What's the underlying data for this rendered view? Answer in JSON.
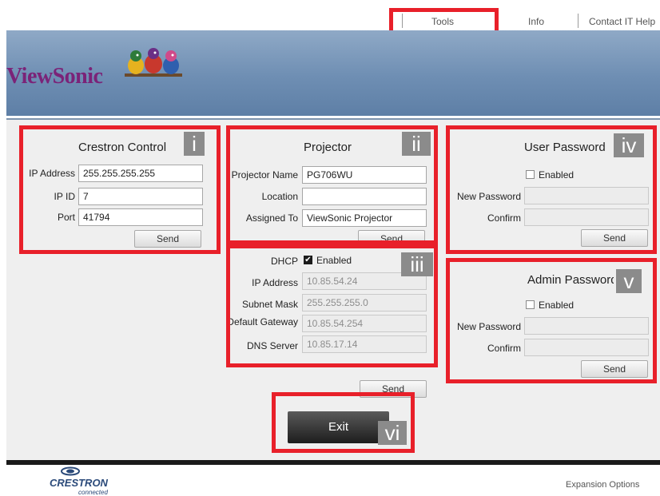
{
  "topnav": {
    "tools": "Tools",
    "info": "Info",
    "contact": "Contact IT Help"
  },
  "brand": {
    "logo_text": "ViewSonic"
  },
  "crestron": {
    "title": "Crestron Control",
    "tag": "i",
    "ip_label": "IP Address",
    "ip_value": "255.255.255.255",
    "ipid_label": "IP ID",
    "ipid_value": "7",
    "port_label": "Port",
    "port_value": "41794",
    "send": "Send"
  },
  "projector": {
    "title": "Projector",
    "tag": "ii",
    "name_label": "Projector Name",
    "name_value": "PG706WU",
    "location_label": "Location",
    "location_value": "",
    "assigned_label": "Assigned To",
    "assigned_value": "ViewSonic Projector",
    "send": "Send"
  },
  "network": {
    "tag": "iii",
    "dhcp_label": "DHCP",
    "dhcp_checked": true,
    "dhcp_text": "Enabled",
    "ip_label": "IP Address",
    "ip_value": "10.85.54.24",
    "mask_label": "Subnet Mask",
    "mask_value": "255.255.255.0",
    "gateway_label": "Default Gateway",
    "gateway_value": "10.85.54.254",
    "dns_label": "DNS Server",
    "dns_value": "10.85.17.14",
    "send": "Send"
  },
  "user_password": {
    "title": "User Password",
    "tag": "iv",
    "enabled_text": "Enabled",
    "new_label": "New Password",
    "confirm_label": "Confirm",
    "send": "Send"
  },
  "admin_password": {
    "title": "Admin Password",
    "tag": "v",
    "enabled_text": "Enabled",
    "new_label": "New Password",
    "confirm_label": "Confirm",
    "send": "Send"
  },
  "exit": {
    "label": "Exit",
    "tag": "vi"
  },
  "footer": {
    "crestron_logo": "CRESTRON",
    "crestron_sub": "connected",
    "expansion": "Expansion Options"
  },
  "colors": {
    "highlight": "#e8202a",
    "banner": "#6e8eb3",
    "logo": "#7b2378"
  }
}
